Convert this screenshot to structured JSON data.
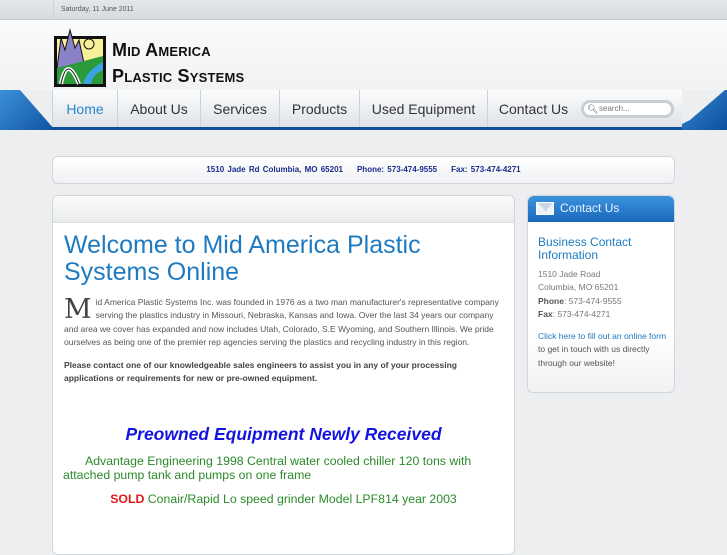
{
  "date": "Saturday, 11 June 2011",
  "brand": {
    "line1": "Mid America",
    "line2": "Plastic Systems"
  },
  "nav": [
    {
      "label": "Home",
      "active": true
    },
    {
      "label": "About Us"
    },
    {
      "label": "Services"
    },
    {
      "label": "Products"
    },
    {
      "label": "Used Equipment"
    },
    {
      "label": "Contact Us"
    }
  ],
  "search": {
    "placeholder": "search..."
  },
  "address_bar": {
    "address": "1510 Jade Rd Columbia, MO 65201",
    "phone": "Phone:  573-474-9555",
    "fax": "Fax: 573-474-4271"
  },
  "main": {
    "title": "Welcome to Mid America Plastic Systems Online",
    "dropcap": "M",
    "intro": "id America Plastic Systems Inc. was founded in 1976 as a two man manufacturer's representative company serving the plastics industry in Missouri, Nebraska, Kansas and Iowa. Over the last 34 years our company and area we cover has expanded and now includes Utah, Colorado, S.E Wyoming, and Southern Illinois. We pride ourselves as being one of the premier rep agencies serving the plastics and recycling industry in this region.",
    "contact_note": "Please contact one of our knowledgeable sales engineers to assist you in any of your processing applications or requirements for new or pre-owned equipment.",
    "preowned_heading": "Preowned Equipment Newly Received",
    "item1": "Advantage Engineering 1998  Central water cooled chiller 120 tons with attached pump tank and pumps on one frame",
    "item2_status": "SOLD",
    "item2": " Conair/Rapid Lo speed grinder Model LPF814 year 2003"
  },
  "sidebar": {
    "header": "Contact Us",
    "title": "Business Contact Information",
    "street": "1510 Jade Road",
    "city": "Columbia, MO 65201",
    "phone_label": "Phone",
    "phone": ": 573-474-9555",
    "fax_label": "Fax",
    "fax": ": 573-474-4271",
    "link": "Click here to fill out an online form",
    "link_suffix": " to get in touch with us directly through our website!"
  }
}
